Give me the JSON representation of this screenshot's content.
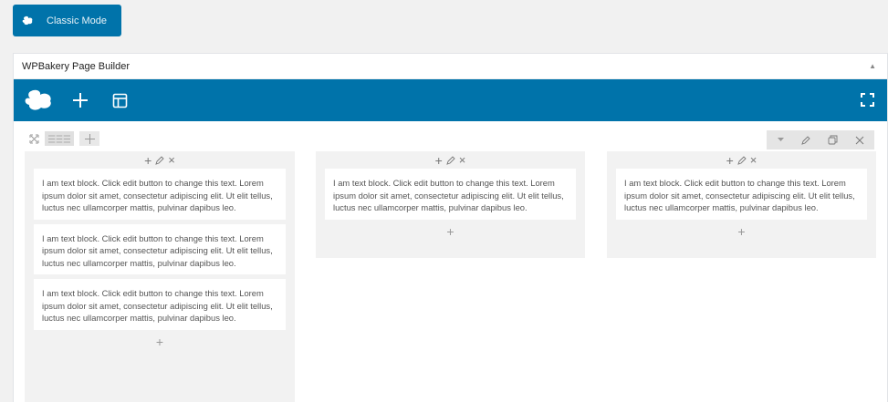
{
  "classic_mode": {
    "label": "Classic Mode"
  },
  "panel": {
    "title": "WPBakery Page Builder",
    "toggle": "▲"
  },
  "text_block": "I am text block. Click edit button to change this text. Lorem ipsum dolor sit amet, consectetur adipiscing elit. Ut elit tellus, luctus nec ullamcorper mattis, pulvinar dapibus leo.",
  "columns": [
    {
      "blocks": [
        "I am text block. Click edit button to change this text. Lorem ipsum dolor sit amet, consectetur adipiscing elit. Ut elit tellus, luctus nec ullamcorper mattis, pulvinar dapibus leo.",
        "I am text block. Click edit button to change this text. Lorem ipsum dolor sit amet, consectetur adipiscing elit. Ut elit tellus, luctus nec ullamcorper mattis, pulvinar dapibus leo.",
        "I am text block. Click edit button to change this text. Lorem ipsum dolor sit amet, consectetur adipiscing elit. Ut elit tellus, luctus nec ullamcorper mattis, pulvinar dapibus leo."
      ]
    },
    {
      "blocks": [
        "I am text block. Click edit button to change this text. Lorem ipsum dolor sit amet, consectetur adipiscing elit. Ut elit tellus, luctus nec ullamcorper mattis, pulvinar dapibus leo."
      ]
    },
    {
      "blocks": [
        "I am text block. Click edit button to change this text. Lorem ipsum dolor sit amet, consectetur adipiscing elit. Ut elit tellus, luctus nec ullamcorper mattis, pulvinar dapibus leo."
      ]
    }
  ],
  "icons": {
    "classic": "cloud-icon",
    "logo": "wpbakery-logo-icon",
    "add": "plus-icon",
    "templates": "layout-icon",
    "fullscreen": "fullscreen-icon",
    "row_move": "move-icon",
    "row_layout": "column-layout-icon",
    "row_toggle": "chevron-down-icon",
    "edit": "pencil-icon",
    "clone": "clone-icon",
    "delete": "close-icon"
  },
  "colors": {
    "accent": "#0073aa",
    "background": "#f1f1f1",
    "column_bg": "#f2f2f2"
  }
}
